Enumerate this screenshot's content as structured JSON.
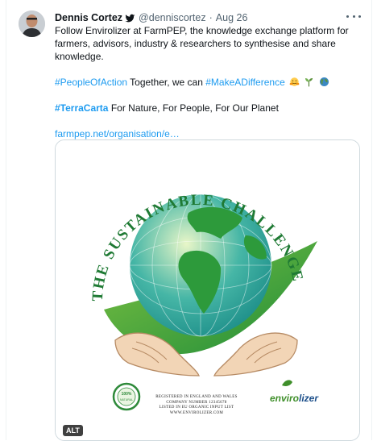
{
  "tweet": {
    "author_name": "Dennis Cortez",
    "handle": "@denniscortez",
    "separator": "·",
    "date": "Aug 26",
    "text_line1": "Follow Envirolizer at FarmPEP, the knowledge exchange platform for farmers, advisors, industry & researchers to synthesise and share knowledge.",
    "hashtag1": "#PeopleOfAction",
    "text_line2": " Together, we can ",
    "hashtag2": "#MakeADifference",
    "hashtag3": "#TerraCarta",
    "text_line3": " For Nature, For People, For Our Planet",
    "link": "farmpep.net/organisation/e…"
  },
  "image": {
    "arc_title": "THE SUSTAINABLE CHALLENGE",
    "seal_text": "100% Premium Quality NATURAL",
    "reg_line1": "REGISTERED IN ENGLAND AND WALES",
    "reg_line2": "COMPANY NUMBER 12345678",
    "reg_line3": "LISTED IN EU ORGANIC INPUT LIST",
    "reg_line4": "WWW.ENVIROLIZER.COM",
    "logo_part1": "enviro",
    "logo_part2": "lizer",
    "alt_badge": "ALT"
  },
  "colors": {
    "link_blue": "#1d9bf0",
    "text_primary": "#0f1419",
    "text_secondary": "#536471",
    "leaf_green": "#2e9a3c",
    "globe_teal": "#22a7a0"
  },
  "icons": [
    "verified-badge-icon",
    "more-options-icon",
    "hugging-face-icon",
    "seedling-icon",
    "globe-icon"
  ]
}
